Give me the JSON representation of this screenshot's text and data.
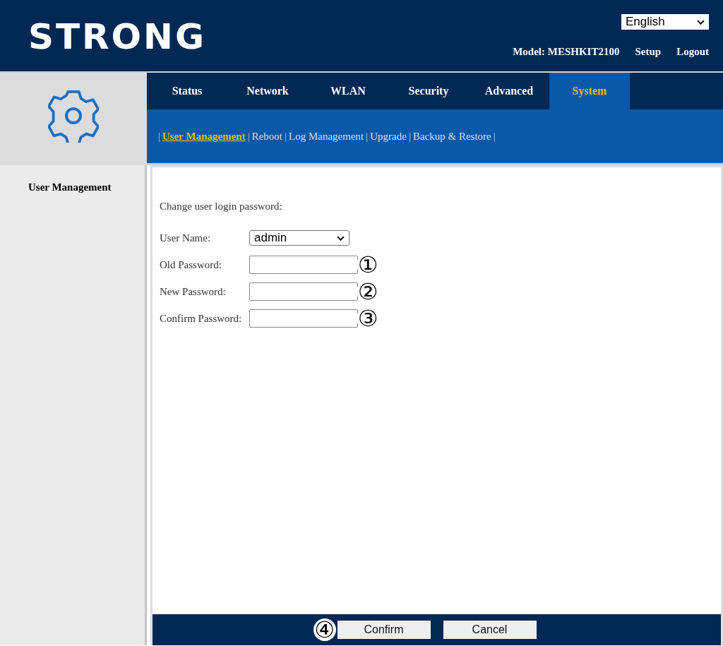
{
  "header": {
    "logo": "STRONG",
    "language": "English",
    "model": "Model: MESHKIT2100",
    "links": [
      "Setup",
      "Logout"
    ]
  },
  "tabs": [
    {
      "label": "Status",
      "selected": false
    },
    {
      "label": "Network",
      "selected": false
    },
    {
      "label": "WLAN",
      "selected": false
    },
    {
      "label": "Security",
      "selected": false
    },
    {
      "label": "Advanced",
      "selected": false
    },
    {
      "label": "System",
      "selected": true
    }
  ],
  "subnav": [
    {
      "kind": "separator",
      "text": "|"
    },
    {
      "kind": "link",
      "label": "User Management",
      "selected": true
    },
    {
      "kind": "separator",
      "text": "|"
    },
    {
      "kind": "link",
      "label": "Reboot",
      "selected": false
    },
    {
      "kind": "separator",
      "text": "|"
    },
    {
      "kind": "link",
      "label": "Log Management",
      "selected": false
    },
    {
      "kind": "separator",
      "text": "|"
    },
    {
      "kind": "link",
      "label": "Upgrade",
      "selected": false
    },
    {
      "kind": "separator",
      "text": "|"
    },
    {
      "kind": "link",
      "label": "Backup & Restore",
      "selected": false
    },
    {
      "kind": "separator",
      "text": "|"
    }
  ],
  "sidebar": {
    "items": [
      {
        "label": "User Management",
        "selected": true
      }
    ]
  },
  "form": {
    "heading": "Change user login password:",
    "fields": [
      {
        "kind": "select",
        "label": "User Name:",
        "value": "admin"
      },
      {
        "kind": "password",
        "label": "Old Password:",
        "callout": "①"
      },
      {
        "kind": "password",
        "label": "New Password:",
        "callout": "②"
      },
      {
        "kind": "password",
        "label": "Confirm Password:",
        "callout": "③"
      }
    ]
  },
  "footer": {
    "buttons": [
      {
        "label": "Confirm",
        "callout": "④"
      },
      {
        "label": "Cancel"
      }
    ]
  }
}
